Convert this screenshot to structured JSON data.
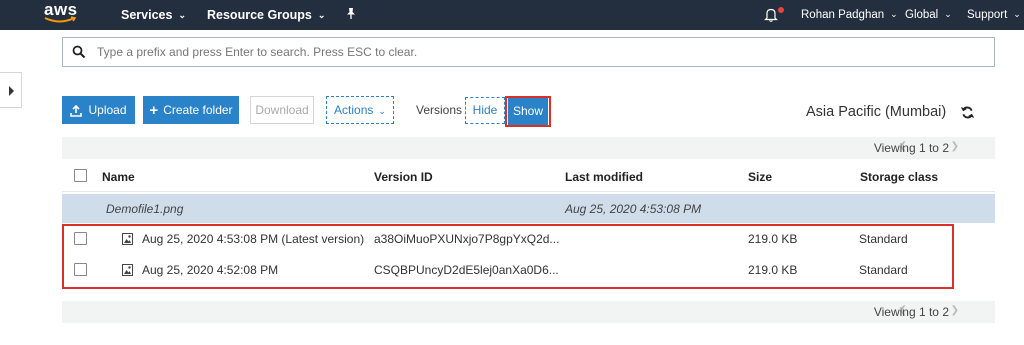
{
  "topbar": {
    "logo_text": "aws",
    "services": "Services",
    "resource_groups": "Resource Groups",
    "user": "Rohan Padghan",
    "region_menu": "Global",
    "support": "Support"
  },
  "search": {
    "placeholder": "Type a prefix and press Enter to search. Press ESC to clear."
  },
  "toolbar": {
    "upload": "Upload",
    "create_folder": "Create folder",
    "download": "Download",
    "actions": "Actions",
    "versions_label": "Versions",
    "hide": "Hide",
    "show": "Show"
  },
  "region": "Asia Pacific (Mumbai)",
  "pagination": {
    "top": "Viewing 1 to 2",
    "bottom": "Viewing 1 to 2"
  },
  "table": {
    "columns": [
      "Name",
      "Version ID",
      "Last modified",
      "Size",
      "Storage class"
    ],
    "group": {
      "name": "Demofile1.png",
      "last_modified": "Aug 25, 2020 4:53:08 PM"
    },
    "rows": [
      {
        "name": "Aug 25, 2020 4:53:08 PM (Latest version)",
        "version_id": "a38OiMuoPXUNxjo7P8gpYxQ2d...",
        "size": "219.0 KB",
        "storage_class": "Standard"
      },
      {
        "name": "Aug 25, 2020 4:52:08 PM",
        "version_id": "CSQBPUncyD2dE5lej0anXa0D6...",
        "size": "219.0 KB",
        "storage_class": "Standard"
      }
    ]
  },
  "colors": {
    "topbar_bg": "#232f3e",
    "primary_blue": "#2a82c9",
    "group_row_bg": "#cfdce9",
    "highlight_red": "#d9312a"
  }
}
